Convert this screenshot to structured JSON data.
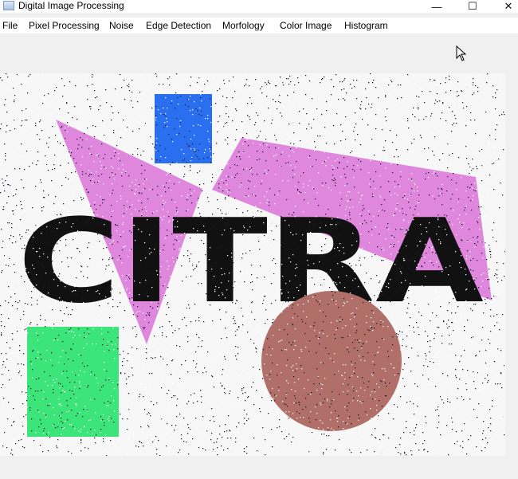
{
  "window": {
    "title": "Digital Image Processing",
    "controls": {
      "minimize": "—",
      "maximize": "☐",
      "close": "✕"
    }
  },
  "menu": {
    "items": [
      "File",
      "Pixel Processing",
      "Noise",
      "Edge Detection",
      "Morfology",
      "Color Image",
      "Histogram"
    ]
  },
  "image": {
    "text": "CITRA",
    "colors": {
      "background": "#f7f7f7",
      "blue_rect": "#2a6ff0",
      "pink_shape": "#df86dd",
      "green_rect": "#3ce57a",
      "brown_circle": "#b06f68",
      "text": "#111111",
      "noise_dark": "#1b1b2b",
      "noise_light": "#ffffff"
    },
    "noise": "salt-and-pepper"
  }
}
